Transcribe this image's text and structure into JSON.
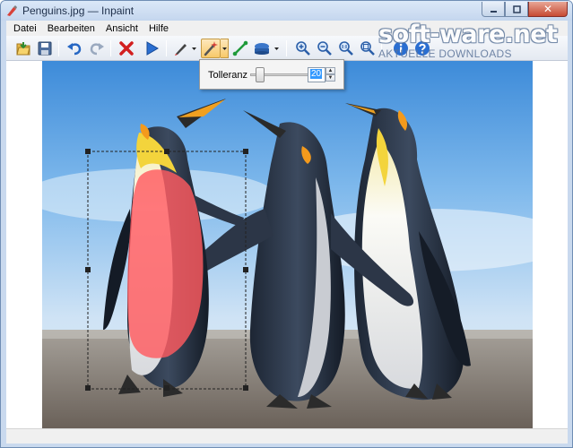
{
  "window": {
    "title": "Penguins.jpg — Inpaint",
    "close_label": "✕"
  },
  "menu": [
    "Datei",
    "Bearbeiten",
    "Ansicht",
    "Hilfe"
  ],
  "toolbar": {
    "icons": [
      "open-icon",
      "save-icon",
      "undo-icon",
      "redo-icon",
      "erase-icon",
      "run-icon",
      "marker-icon",
      "magic-wand-icon",
      "line-icon",
      "stamp-icon",
      "zoom-in-icon",
      "zoom-out-icon",
      "zoom-actual-icon",
      "zoom-fit-icon",
      "info-icon",
      "help-icon"
    ],
    "active_tool": "magic-wand-icon"
  },
  "tolerance_popup": {
    "label": "Tolleranz",
    "value": "20",
    "level_fraction": 0.1
  },
  "watermark": {
    "main": "soft-ware.net",
    "sub": "AKTUELLE DOWNLOADS"
  },
  "colors": {
    "accent": "#f8c969",
    "selection_overlay": "#ff5a5f",
    "window_frame": "#c9d9ee"
  }
}
